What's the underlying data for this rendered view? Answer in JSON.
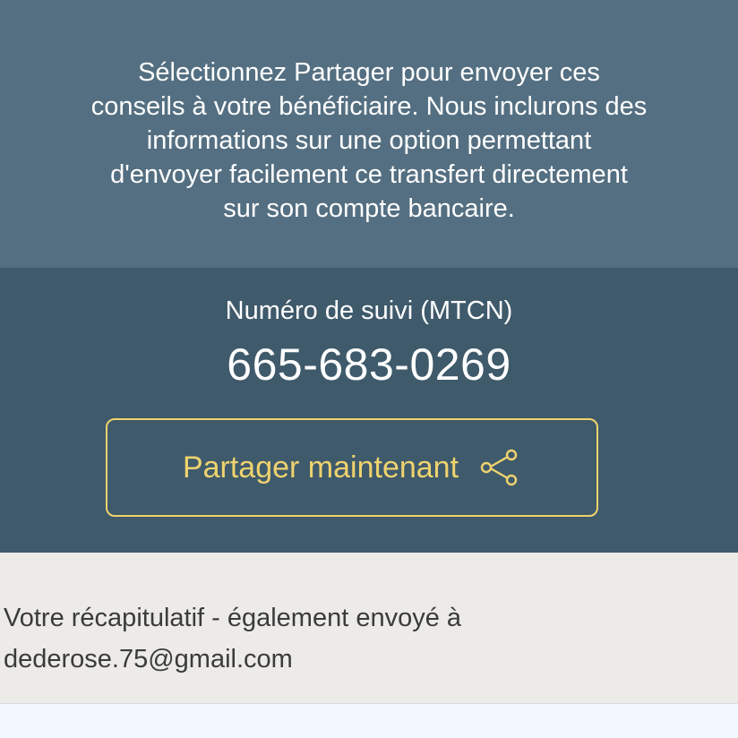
{
  "info": {
    "message": "Sélectionnez Partager pour envoyer ces\nconseils à votre bénéficiaire. Nous inclurons des\ninformations sur une option permettant\nd'envoyer facilement ce transfert directement\nsur son compte bancaire."
  },
  "tracking": {
    "label": "Numéro de suivi (MTCN)",
    "number": "665-683-0269"
  },
  "share": {
    "label": "Partager maintenant",
    "icon": "share-icon"
  },
  "summary": {
    "label": "Votre récapitulatif - également envoyé à",
    "email": "dederose.75@gmail.com"
  },
  "colors": {
    "info_background": "#546f81",
    "tracking_background": "#3f5a6b",
    "accent": "#efd36e",
    "summary_background": "#ecebe8"
  }
}
